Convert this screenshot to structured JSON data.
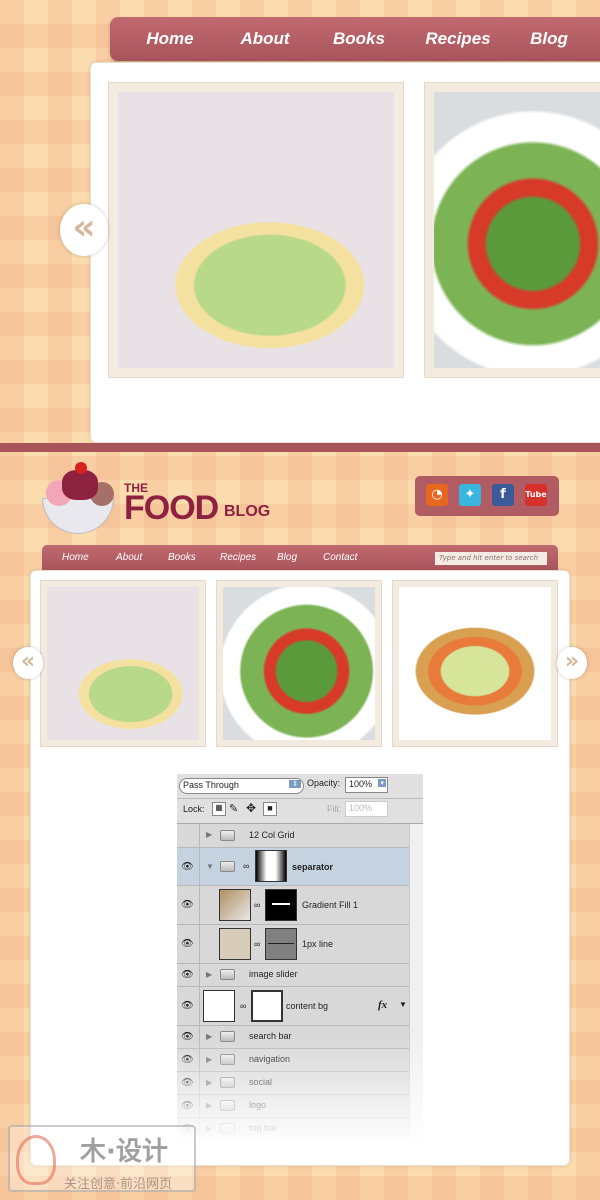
{
  "top_preview": {
    "nav": [
      "Home",
      "About",
      "Books",
      "Recipes",
      "Blog"
    ],
    "prev_arrow": "«"
  },
  "site": {
    "logo": {
      "the": "THE",
      "food": "FOOD",
      "blog": "BLOG"
    },
    "social": [
      "rss-icon",
      "twitter-icon",
      "facebook-icon",
      "youtube-icon"
    ],
    "social_labels": {
      "rss": "",
      "twitter": "",
      "facebook": "f",
      "youtube": "Tube"
    },
    "nav": [
      "Home",
      "About",
      "Books",
      "Recipes",
      "Blog",
      "Contact"
    ],
    "search_placeholder": "Type and hit enter to search",
    "prev_arrow": "«",
    "next_arrow": "»"
  },
  "layers_panel": {
    "blend_mode": "Pass Through",
    "opacity_label": "Opacity:",
    "opacity": "100%",
    "lock_label": "Lock:",
    "fill_label": "Fill:",
    "fill": "100%",
    "layers": [
      {
        "name": "12 Col Grid",
        "visible": false,
        "type": "group"
      },
      {
        "name": "separator",
        "visible": true,
        "type": "group",
        "expanded": true,
        "selected": true
      },
      {
        "name": "Gradient Fill 1",
        "visible": true,
        "type": "fill"
      },
      {
        "name": "1px line",
        "visible": true,
        "type": "fill"
      },
      {
        "name": "image slider",
        "visible": true,
        "type": "group"
      },
      {
        "name": "content bg",
        "visible": true,
        "type": "layer",
        "fx": "fx"
      },
      {
        "name": "search bar",
        "visible": true,
        "type": "group"
      },
      {
        "name": "navigation",
        "visible": true,
        "type": "group"
      },
      {
        "name": "social",
        "visible": true,
        "type": "group"
      },
      {
        "name": "logo",
        "visible": true,
        "type": "group"
      },
      {
        "name": "top bar",
        "visible": true,
        "type": "group"
      }
    ]
  },
  "watermark": {
    "title": "木·设计",
    "subtitle": "关注创意·前沿网页"
  },
  "colors": {
    "accent": "#a9545b",
    "logo": "#8d2140",
    "background": "#fbdcae",
    "selected_layer": "#c5d2e0"
  }
}
